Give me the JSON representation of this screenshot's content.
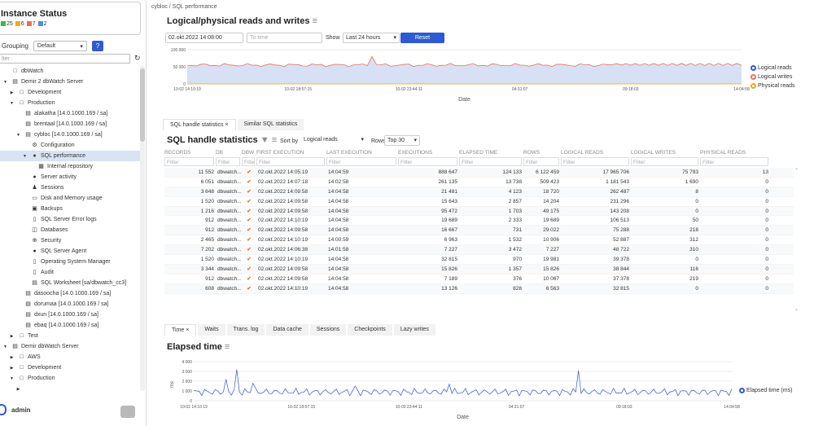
{
  "instance_status": {
    "title": "Instance Status",
    "counts": [
      {
        "value": "25",
        "color": "#4caf50"
      },
      {
        "value": "6",
        "color": "#f5a623"
      },
      {
        "value": "7",
        "color": "#e57357"
      },
      {
        "value": "2",
        "color": "#4a90e2"
      }
    ]
  },
  "grouping": {
    "label": "Grouping",
    "value": "Default",
    "help": "?"
  },
  "filter_placeholder": "lter",
  "tree": [
    {
      "label": "dbWatch",
      "indent": 0,
      "icon": "□",
      "arrow": ""
    },
    {
      "label": "Demir 2 dbWatch Server",
      "indent": 0,
      "icon": "▤",
      "arrow": "▼"
    },
    {
      "label": "Development",
      "indent": 1,
      "icon": "□",
      "arrow": "▶"
    },
    {
      "label": "Production",
      "indent": 1,
      "icon": "□",
      "arrow": "▼"
    },
    {
      "label": "alakatha [14.0.1000.169 / sa]",
      "indent": 2,
      "icon": "▤",
      "arrow": ""
    },
    {
      "label": "brentaal [14.0.1000.169 / sa]",
      "indent": 2,
      "icon": "▤",
      "arrow": ""
    },
    {
      "label": "cybloc [14.0.1000.169 / sa]",
      "indent": 2,
      "icon": "▤",
      "arrow": "▼"
    },
    {
      "label": "Configuration",
      "indent": 3,
      "icon": "⚙",
      "arrow": ""
    },
    {
      "label": "SQL performance",
      "indent": 3,
      "icon": "●",
      "arrow": "▼",
      "selected": true
    },
    {
      "label": "Internal repository",
      "indent": 4,
      "icon": "▦",
      "arrow": ""
    },
    {
      "label": "Server activity",
      "indent": 3,
      "icon": "●",
      "arrow": ""
    },
    {
      "label": "Sessions",
      "indent": 3,
      "icon": "♟",
      "arrow": ""
    },
    {
      "label": "Disk and Memory usage",
      "indent": 3,
      "icon": "▭",
      "arrow": ""
    },
    {
      "label": "Backups",
      "indent": 3,
      "icon": "▣",
      "arrow": ""
    },
    {
      "label": "SQL Server Error logs",
      "indent": 3,
      "icon": "▯",
      "arrow": ""
    },
    {
      "label": "Databases",
      "indent": 3,
      "icon": "◫",
      "arrow": ""
    },
    {
      "label": "Security",
      "indent": 3,
      "icon": "⊕",
      "arrow": ""
    },
    {
      "label": "SQL Server Agent",
      "indent": 3,
      "icon": "●",
      "arrow": ""
    },
    {
      "label": "Operating System Manager",
      "indent": 3,
      "icon": "▯",
      "arrow": ""
    },
    {
      "label": "Audit",
      "indent": 3,
      "icon": "▯",
      "arrow": ""
    },
    {
      "label": "SQL Worksheet [sa/dbwatch_cc3]",
      "indent": 3,
      "icon": "▤",
      "arrow": ""
    },
    {
      "label": "dasoocha [14.0.1000.169 / sa]",
      "indent": 2,
      "icon": "▤",
      "arrow": ""
    },
    {
      "label": "dorumaa [14.0.1000.169 / sa]",
      "indent": 2,
      "icon": "▤",
      "arrow": ""
    },
    {
      "label": "dxun [14.0.1000.169 / sa]",
      "indent": 2,
      "icon": "▤",
      "arrow": ""
    },
    {
      "label": "ebaq [14.0.1000.169 / sa]",
      "indent": 2,
      "icon": "▤",
      "arrow": ""
    },
    {
      "label": "Test",
      "indent": 1,
      "icon": "□",
      "arrow": "▶"
    },
    {
      "label": "Demir dbWatch Server",
      "indent": 0,
      "icon": "▤",
      "arrow": "▼"
    },
    {
      "label": "AWS",
      "indent": 1,
      "icon": "□",
      "arrow": "▶"
    },
    {
      "label": "Development",
      "indent": 1,
      "icon": "□",
      "arrow": "▶"
    },
    {
      "label": "Production",
      "indent": 1,
      "icon": "□",
      "arrow": "▼"
    },
    {
      "label": "",
      "indent": 2,
      "icon": "",
      "arrow": "▶"
    }
  ],
  "user": {
    "name": "admin"
  },
  "breadcrumb": "cybloc / SQL performance",
  "reads": {
    "title": "Logical/physical reads and writes",
    "from": "02.okt.2022 14:08:00",
    "to_placeholder": "To time",
    "show_label": "Show",
    "range": "Last 24 hours",
    "reset": "Reset",
    "y_ticks": [
      "100 000",
      "50 000",
      "0"
    ],
    "x_ticks": [
      "10-02 14:10:19",
      "10-02 18:57:15",
      "10-02 23:44:11",
      "04:31:07",
      "09:18:03",
      "14:04:58"
    ],
    "xlabel": "Date",
    "legend": [
      {
        "name": "Logical reads",
        "color": "#2d5bd0"
      },
      {
        "name": "Logical writes",
        "color": "#e57357"
      },
      {
        "name": "Physical reads",
        "color": "#f5a623"
      }
    ]
  },
  "tabs1": [
    "SQL handle statistics ×",
    "Similar SQL statistics"
  ],
  "handle": {
    "title": "SQL handle statistics",
    "sort_label": "Sort by",
    "sort_value": "Logical reads",
    "rows_label": "Rows",
    "rows_value": "Top 30",
    "columns": [
      "RECORDS",
      "DB",
      "DBW",
      "FIRST EXECUTION",
      "LAST EXECUTION",
      "EXECUTIONS",
      "ELAPSED TIME",
      "ROWS",
      "LOGICAL READS",
      "LOGICAL WRITES",
      "PHYSICAL READS"
    ],
    "filter": "Filter",
    "filter_short": "Filte",
    "rows": [
      [
        "11 552",
        "dbwatch...",
        "✔",
        "02.okt.2022 14:05:19",
        "14:04:59",
        "888 647",
        "124 133",
        "6 122 459",
        "17 965 706",
        "75 793",
        "13"
      ],
      [
        "6 051",
        "dbwatch...",
        "✔",
        "02.okt.2022 14:07:18",
        "14:02:58",
        "261 135",
        "13 738",
        "509 423",
        "1 181 543",
        "1 690",
        "0"
      ],
      [
        "3 648",
        "dbwatch...",
        "✔",
        "02.okt.2022 14:09:58",
        "14:04:58",
        "21 481",
        "4 123",
        "18 720",
        "262 487",
        "8",
        "0"
      ],
      [
        "1 520",
        "dbwatch...",
        "✔",
        "02.okt.2022 14:09:58",
        "14:04:58",
        "15 643",
        "2 857",
        "14 204",
        "231 296",
        "0",
        "0"
      ],
      [
        "1 216",
        "dbwatch...",
        "✔",
        "02.okt.2022 14:09:58",
        "14:04:58",
        "95 472",
        "1 703",
        "49 175",
        "143 208",
        "0",
        "0"
      ],
      [
        "912",
        "dbwatch...",
        "✔",
        "02.okt.2022 14:10:19",
        "14:04:58",
        "19 689",
        "2 333",
        "19 689",
        "106 513",
        "50",
        "0"
      ],
      [
        "912",
        "dbwatch...",
        "✔",
        "02.okt.2022 14:09:58",
        "14:04:58",
        "16 667",
        "731",
        "29 022",
        "75 288",
        "218",
        "0"
      ],
      [
        "2 465",
        "dbwatch...",
        "✔",
        "02.okt.2022 14:10:19",
        "14:00:59",
        "6 963",
        "1 532",
        "10 906",
        "52 887",
        "312",
        "0"
      ],
      [
        "7 202",
        "dbwatch...",
        "✔",
        "02.okt.2022 14:06:38",
        "14:01:58",
        "7 227",
        "3 472",
        "7 227",
        "48 722",
        "310",
        "0"
      ],
      [
        "1 520",
        "dbwatch...",
        "✔",
        "02.okt.2022 14:10:19",
        "14:04:58",
        "32 815",
        "970",
        "19 981",
        "39 378",
        "0",
        "0"
      ],
      [
        "3 344",
        "dbwatch...",
        "✔",
        "02.okt.2022 14:09:58",
        "14:04:58",
        "15 826",
        "1 357",
        "15 826",
        "38 844",
        "116",
        "0"
      ],
      [
        "912",
        "dbwatch...",
        "✔",
        "02.okt.2022 14:09:58",
        "14:04:58",
        "7 189",
        "376",
        "10 067",
        "37 378",
        "219",
        "0"
      ],
      [
        "608",
        "dbwatch...",
        "✔",
        "02.okt.2022 14:10:19",
        "14:04:58",
        "13 126",
        "828",
        "6 563",
        "32 815",
        "0",
        "0"
      ]
    ]
  },
  "tabs2": [
    "Time ×",
    "Waits",
    "Trans. log",
    "Data cache",
    "Sessions",
    "Checkpoints",
    "Lazy writes"
  ],
  "elapsed": {
    "title": "Elapsed time",
    "y_ticks": [
      "4 000",
      "3 000",
      "2 000",
      "1 000",
      "0"
    ],
    "ylabel": "ms",
    "x_ticks": [
      "10-02 14:10:19",
      "10-02 18:57:15",
      "10-02 23:44:11",
      "04:31:07",
      "09:18:03",
      "14:04:58"
    ],
    "xlabel": "Date",
    "legend": "Elapsed time (ms)",
    "color": "#2d5bd0"
  }
}
